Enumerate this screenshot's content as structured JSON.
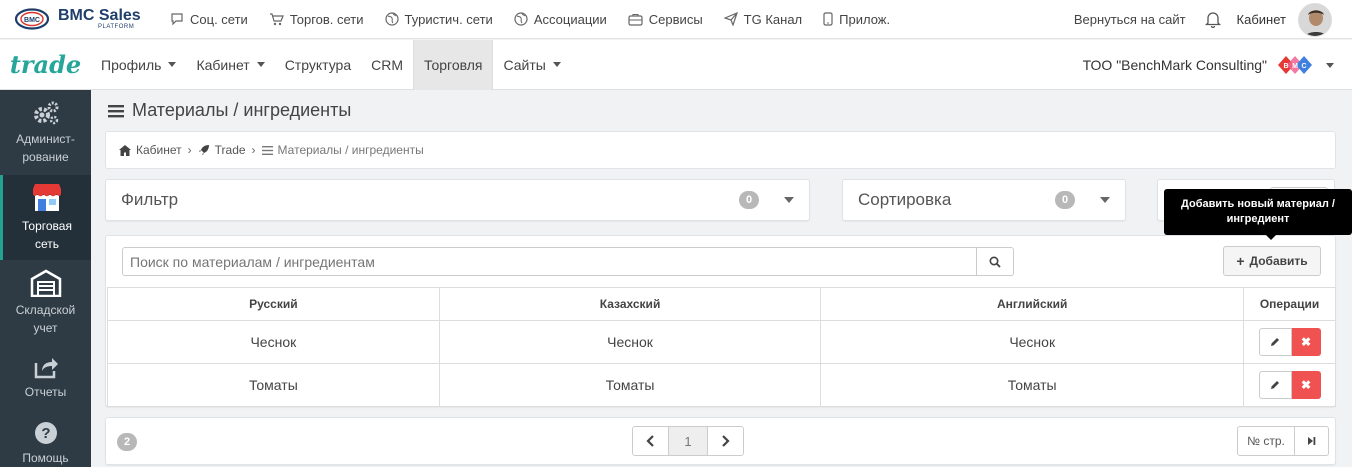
{
  "top": {
    "logo_name": "BMC Sales",
    "logo_sub": "PLATFORM",
    "logo_mark": "BMC",
    "nav": [
      {
        "label": "Соц. сети",
        "icon": "chat-icon"
      },
      {
        "label": "Торгов. сети",
        "icon": "cart-icon"
      },
      {
        "label": "Туристич. сети",
        "icon": "globe-icon"
      },
      {
        "label": "Ассоциации",
        "icon": "globe-icon"
      },
      {
        "label": "Сервисы",
        "icon": "briefcase-icon"
      },
      {
        "label": "TG Канал",
        "icon": "send-icon"
      },
      {
        "label": "Прилож.",
        "icon": "mobile-icon"
      }
    ],
    "back_link": "Вернуться на сайт",
    "cabinet": "Кабинет"
  },
  "second": {
    "brand": "trade",
    "nav": [
      {
        "label": "Профиль",
        "dropdown": true
      },
      {
        "label": "Кабинет",
        "dropdown": true
      },
      {
        "label": "Структура",
        "dropdown": false
      },
      {
        "label": "CRM",
        "dropdown": false
      },
      {
        "label": "Торговля",
        "dropdown": false,
        "active": true
      },
      {
        "label": "Сайты",
        "dropdown": true
      }
    ],
    "company": "ТОО \"BenchMark Consulting\"",
    "company_logo": [
      "B",
      "M",
      "C"
    ]
  },
  "sidebar": [
    {
      "label": "Админист-рование",
      "icon": "cogs-icon"
    },
    {
      "label": "Торговая сеть",
      "icon": "shop-icon",
      "active": true
    },
    {
      "label": "Складской учет",
      "icon": "warehouse-icon"
    },
    {
      "label": "Отчеты",
      "icon": "share-icon"
    },
    {
      "label": "Помощь",
      "icon": "help-icon"
    }
  ],
  "page": {
    "title": "Материалы / ингредиенты",
    "breadcrumb": [
      "Кабинет",
      "Trade",
      "Материалы / ингредиенты"
    ]
  },
  "filter": {
    "label": "Фильтр",
    "count": "0"
  },
  "sort": {
    "label": "Сортировка",
    "count": "0"
  },
  "tooltip": "Добавить новый материал / ингредиент",
  "search": {
    "placeholder": "Поиск по материалам / ингредиентам"
  },
  "add_button": "Добавить",
  "table": {
    "columns": [
      "Русский",
      "Казахский",
      "Английский",
      "Операции"
    ],
    "rows": [
      [
        "Чеснок",
        "Чеснок",
        "Чеснок"
      ],
      [
        "Томаты",
        "Томаты",
        "Томаты"
      ]
    ],
    "delete_symbol": "✖"
  },
  "pagination": {
    "total": "2",
    "current": "1",
    "page_input_placeholder": "№ стр."
  },
  "colors": {
    "accent": "#26a69a",
    "sidebar_bg": "#2f3b44",
    "danger": "#f05252"
  }
}
